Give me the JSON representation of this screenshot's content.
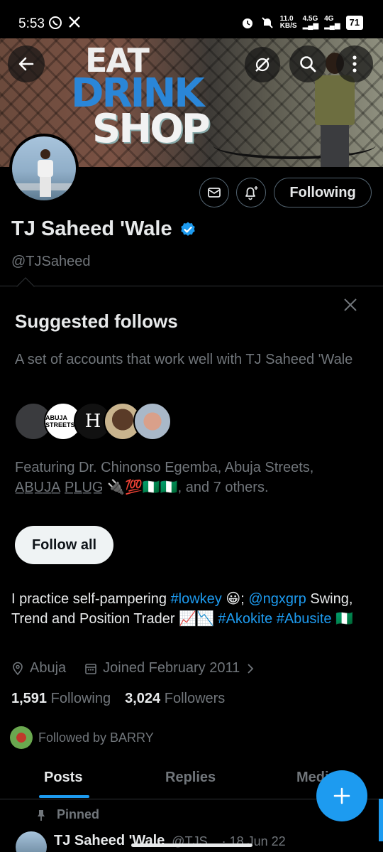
{
  "status_bar": {
    "time": "5:53",
    "speed_top": "11.0",
    "speed_bottom": "KB/S",
    "net1": "4.5G",
    "net2": "4G",
    "battery": "71"
  },
  "banner": {
    "sign_line1": "EAT",
    "sign_line2": "DRINK",
    "sign_line3": "SHOP"
  },
  "profile": {
    "display_name": "TJ Saheed 'Wale",
    "handle": "@TJSaheed",
    "following_button": "Following",
    "verified_color": "#1d9bf0"
  },
  "suggested": {
    "title": "Suggested follows",
    "description": "A set of accounts that work well with TJ Saheed 'Wale",
    "avatar2_text": "ABUJA STREETS",
    "avatar3_text": "H",
    "featuring": "Featuring Dr. Chinonso Egemba, Abuja Streets, A̲B̲U̲J̲A̲ P̲L̲U̲G̲ 🔌💯🇳🇬🇳🇬, and 7 others.",
    "follow_all": "Follow all"
  },
  "bio": {
    "part1": "I practice self-pampering ",
    "tag_lowkey": "#lowkey",
    "part2": " 😀; ",
    "mention": "@ngxgrp",
    "part3": " Swing, Trend and Position Trader 📈📉 ",
    "tag_akokite": "#Akokite",
    "tag_abusite": "#Abusite",
    "part4": " 🇳🇬"
  },
  "meta": {
    "location": "Abuja",
    "joined": "Joined February 2011"
  },
  "counts": {
    "following_num": "1,591",
    "following_label": "Following",
    "followers_num": "3,024",
    "followers_label": "Followers"
  },
  "followed_by": "Followed by BARRY",
  "tabs": {
    "posts": "Posts",
    "replies": "Replies",
    "media": "Media"
  },
  "pinned": {
    "label": "Pinned",
    "author": "TJ Saheed 'Wale",
    "handle_date": "@TJS... · 18 Jun 22"
  },
  "colors": {
    "accent": "#1d9bf0",
    "muted": "#71767b",
    "border": "#2f3336"
  }
}
